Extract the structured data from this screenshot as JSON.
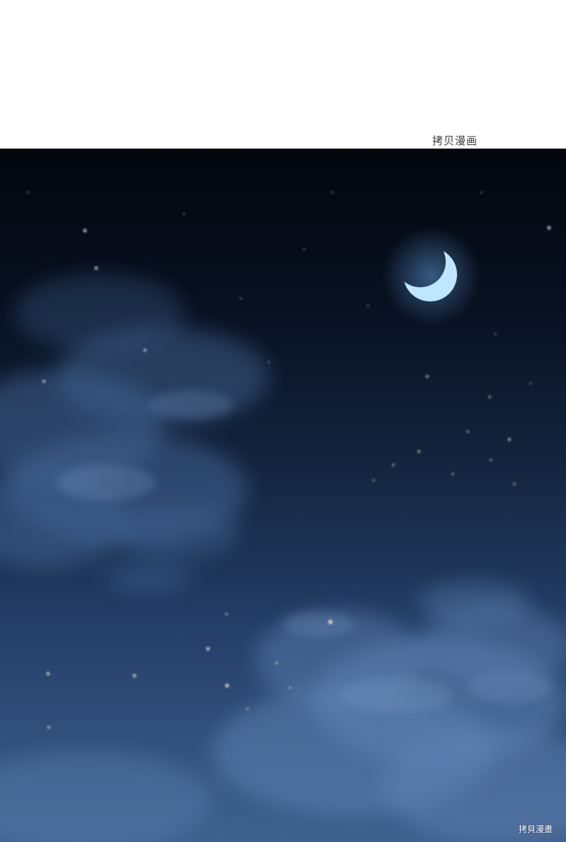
{
  "watermark": {
    "top_text": "拷贝漫画",
    "bottom_text": "拷貝漫畫"
  },
  "scene": {
    "sky_colors": [
      "#04070f",
      "#0b1424",
      "#1a2d4c",
      "#2d4a72",
      "#4b6d98"
    ],
    "moon_color": "#bfe6ff",
    "moon_glow": "#6fb8ff",
    "star_color": "#e6f2ff",
    "ember_color": "#fff1c4",
    "cloud_color": "#5a7fb0"
  }
}
